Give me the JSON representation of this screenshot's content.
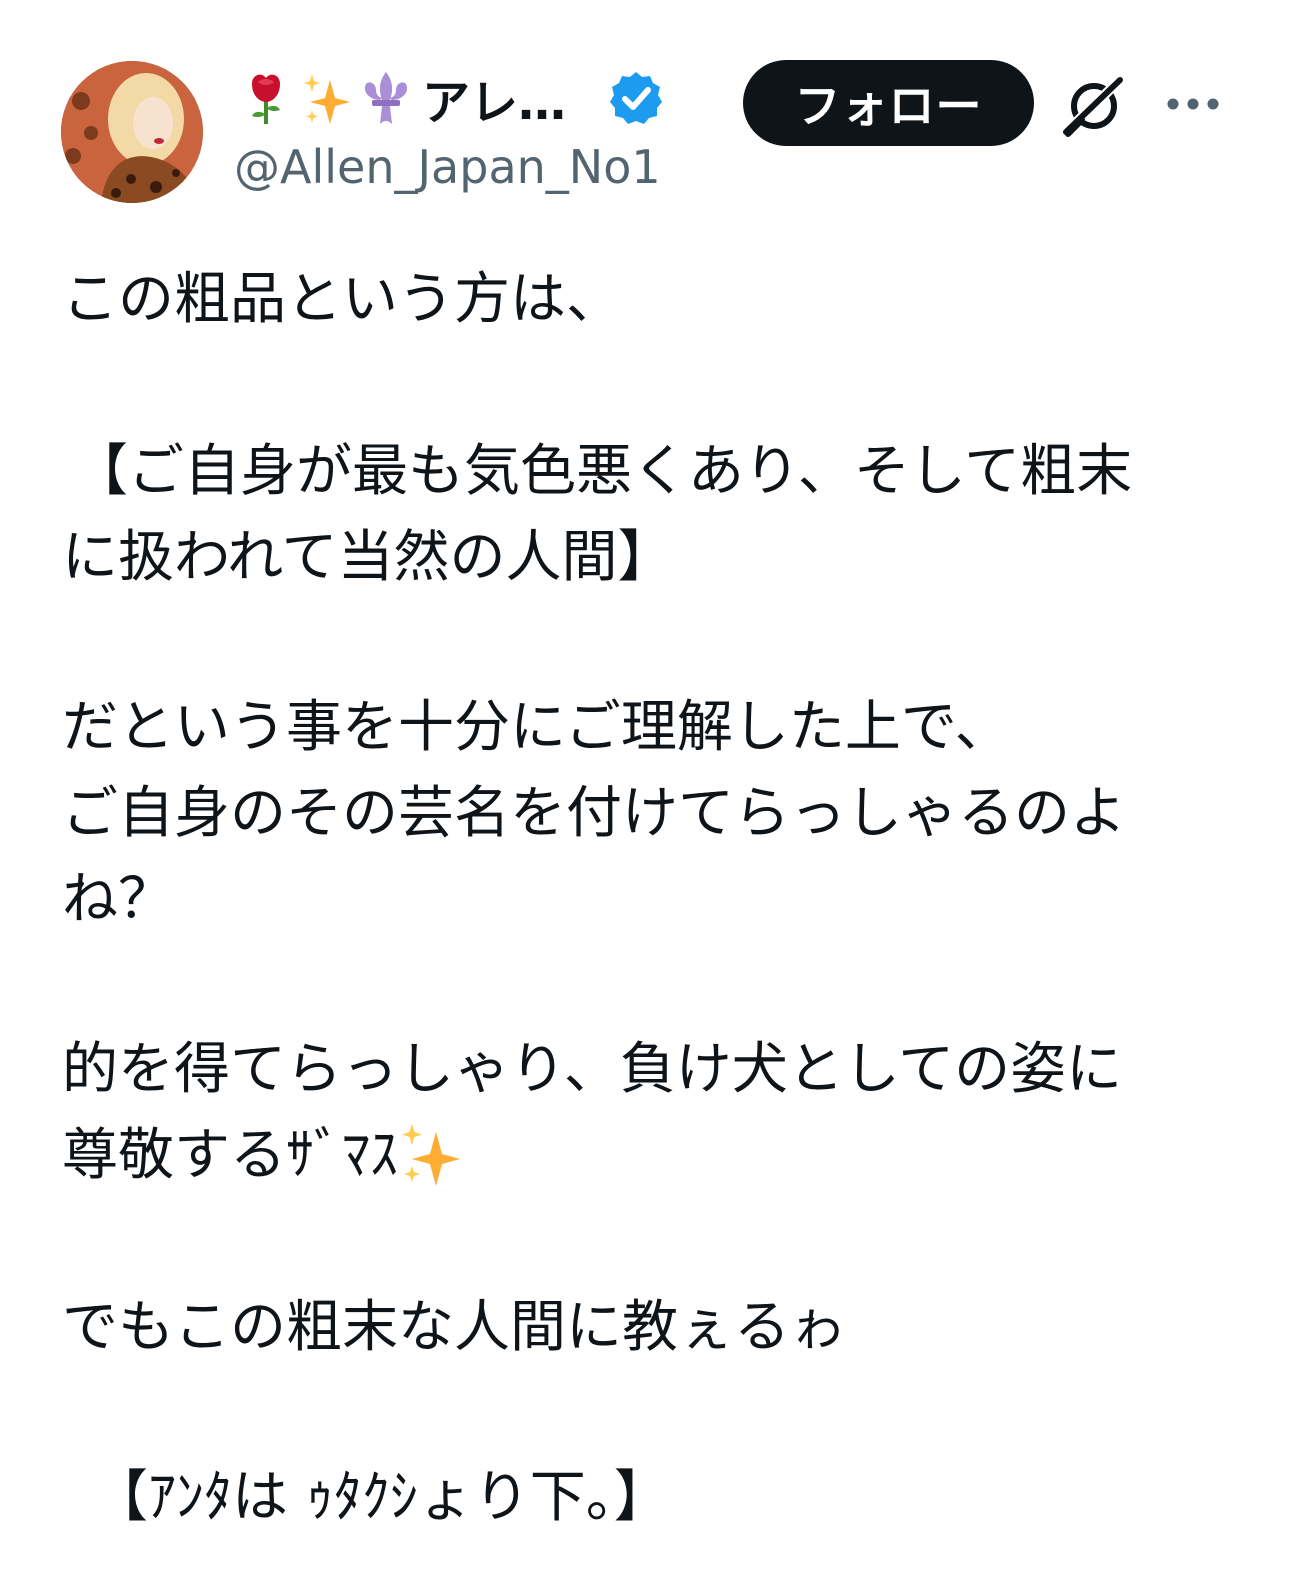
{
  "author": {
    "display_name": "アレ…",
    "handle": "@Allen_Japan_No1",
    "name_emojis": [
      "rose-emoji",
      "sparkles-emoji",
      "fleur-de-lis-emoji"
    ],
    "verified": true,
    "verified_color": "#1d9bf0"
  },
  "actions": {
    "follow_label": "フォロー",
    "grok_icon": "grok-icon",
    "more_icon": "more-icon"
  },
  "tweet": {
    "lines": [
      "この粗品という方は、",
      "【ご自身が最も気色悪くあり、そして粗末",
      "に扱われて当然の人間】",
      "だという事を十分にご理解した上で、",
      "ご自身のその芸名を付けてらっしゃるのよ",
      "ね？",
      "的を得てらっしゃり、負け犬としての姿に",
      "尊敬するｻﾞﾏｽ",
      "でもこの粗末な人間に教ぇるゎ",
      "【ｱﾝﾀは ｩﾀｸｼょり下。】"
    ]
  },
  "colors": {
    "text": "#0f1419",
    "secondary_text": "#536471",
    "follow_bg": "#0f1419",
    "follow_text": "#ffffff"
  }
}
